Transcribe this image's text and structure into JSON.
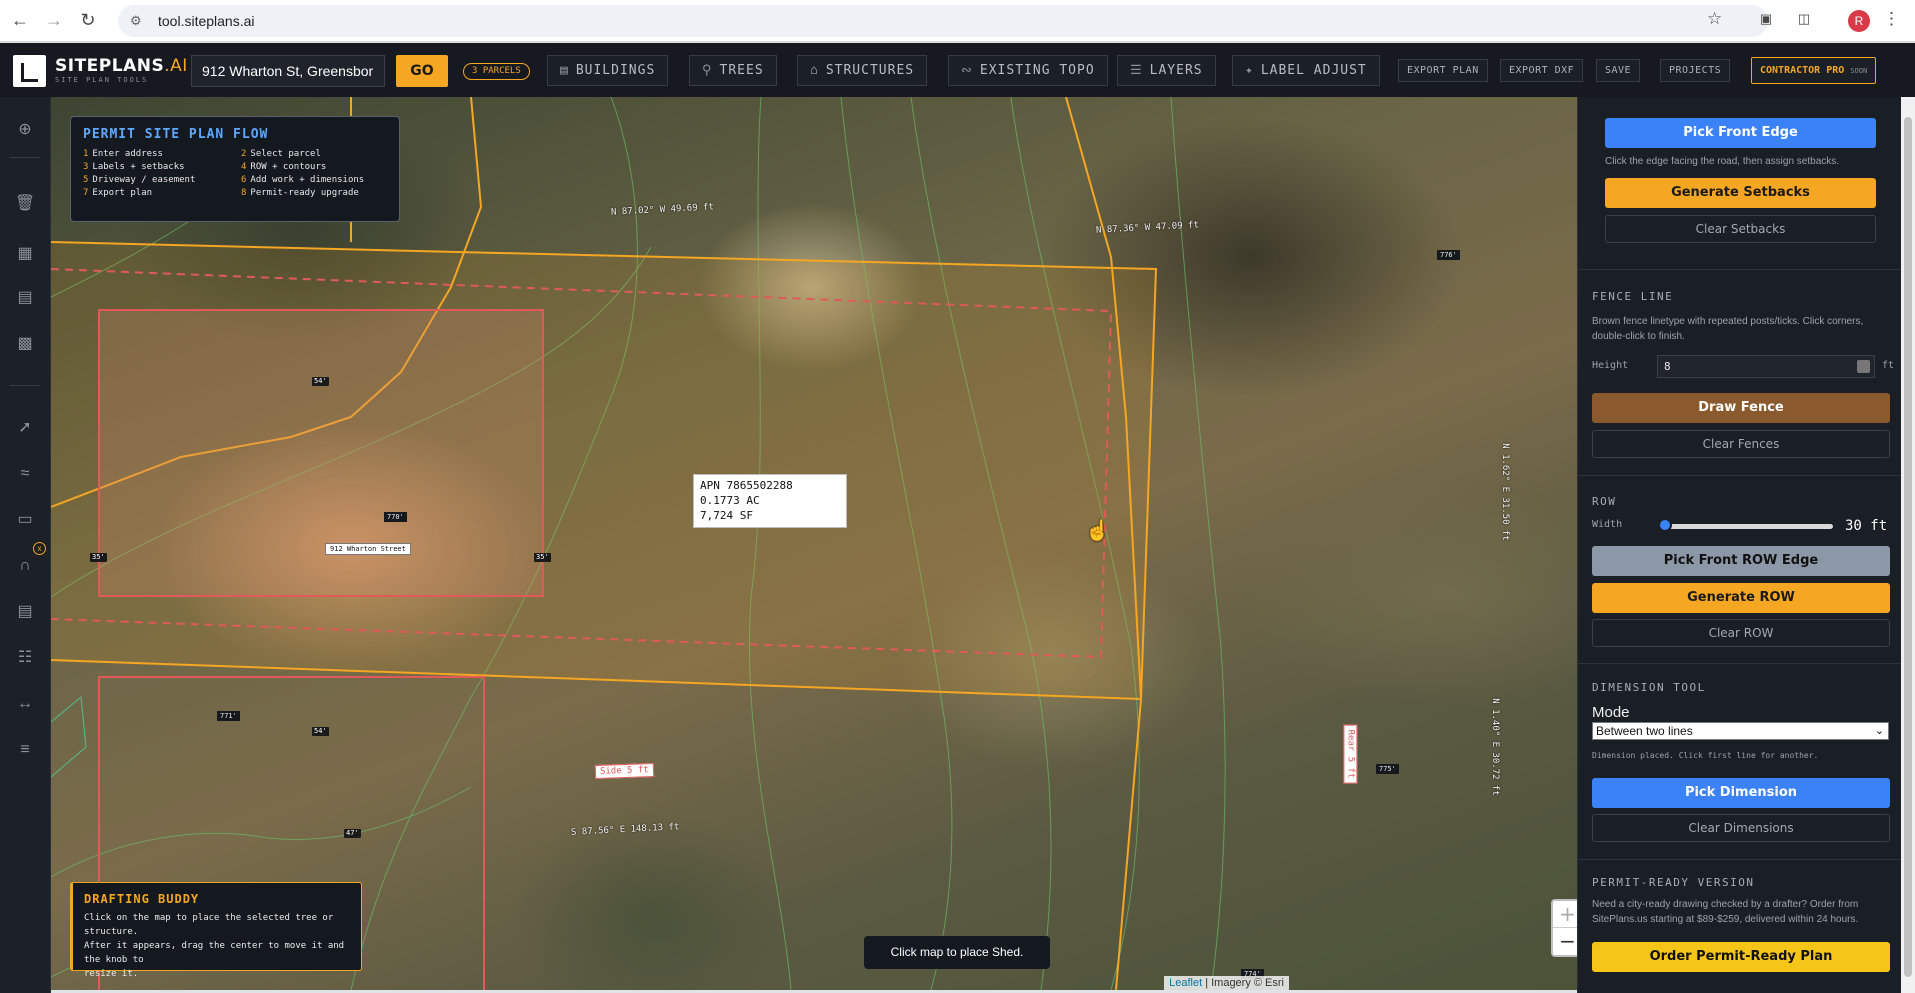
{
  "browser": {
    "url": "tool.siteplans.ai"
  },
  "header": {
    "logo_title": "SITEPLANS",
    "logo_ai": ".AI",
    "logo_subtitle": "SITE PLAN TOOLS",
    "address_value": "912 Wharton St, Greensbor",
    "go_label": "GO",
    "parcel_badge": "3 PARCELS",
    "tools": [
      {
        "label": "BUILDINGS",
        "icon": "building-icon"
      },
      {
        "label": "TREES",
        "icon": "tree-icon"
      },
      {
        "label": "STRUCTURES",
        "icon": "structure-icon"
      },
      {
        "label": "EXISTING TOPO",
        "icon": "topo-icon"
      },
      {
        "label": "LAYERS",
        "icon": "layers-icon"
      },
      {
        "label": "LABEL ADJUST",
        "icon": "label-adjust-icon"
      }
    ],
    "export_plan": "EXPORT PLAN",
    "export_dxf": "EXPORT DXF",
    "save": "SAVE",
    "projects": "PROJECTS",
    "contractor_pro": "CONTRACTOR PRO",
    "soon": "SOON"
  },
  "flow": {
    "title": "PERMIT SITE PLAN FLOW",
    "steps": [
      {
        "n": "1",
        "text": "Enter address"
      },
      {
        "n": "2",
        "text": "Select parcel"
      },
      {
        "n": "3",
        "text": "Labels + setbacks"
      },
      {
        "n": "4",
        "text": "ROW + contours"
      },
      {
        "n": "5",
        "text": "Driveway / easement"
      },
      {
        "n": "6",
        "text": "Add work + dimensions"
      },
      {
        "n": "7",
        "text": "Export plan"
      },
      {
        "n": "8",
        "text": "Permit-ready upgrade"
      }
    ]
  },
  "map": {
    "apn_lines": [
      "APN 7865502288",
      "0.1773 AC",
      "7,724 SF"
    ],
    "street_label": "912 Wharton Street",
    "bearing_top_left": "N 87.02° W 49.69 ft",
    "bearing_top_right": "N 87.36° W 47.09 ft",
    "bearing_bottom": "S 87.56° E 148.13 ft",
    "bearing_right_1": "N 1.62° E 31.50 ft",
    "bearing_right_2": "N 1.40° E 30.72 ft",
    "side_setback": "Side 5 ft",
    "rear_setback": "Rear 5 ft",
    "dims": [
      "54'",
      "54'",
      "35'",
      "35'",
      "47'"
    ],
    "elevations": [
      "770'",
      "771'",
      "776'",
      "775'",
      "774'"
    ],
    "toast": "Click map to place Shed.",
    "attribution_link": "Leaflet",
    "attribution_rest": "| Imagery © Esri",
    "zoom_in": "+",
    "zoom_out": "−"
  },
  "buddy": {
    "title": "DRAFTING BUDDY",
    "line1": "Click on the map to place the selected tree or structure.",
    "line2": "After it appears, drag the center to move it and the knob to",
    "line3": "resize it."
  },
  "panel": {
    "pick_front_edge": "Pick Front Edge",
    "front_edge_note": "Click the edge facing the road, then assign setbacks.",
    "generate_setbacks": "Generate Setbacks",
    "clear_setbacks": "Clear Setbacks",
    "fence_title": "FENCE LINE",
    "fence_note": "Brown fence linetype with repeated posts/ticks. Click corners, double-click to finish.",
    "height_label": "Height",
    "height_value": "8",
    "height_unit": "ft",
    "draw_fence": "Draw Fence",
    "clear_fences": "Clear Fences",
    "row_title": "ROW",
    "width_label": "Width",
    "row_width": "30 ft",
    "row_width_fraction": 0.0,
    "pick_front_row": "Pick Front ROW Edge",
    "generate_row": "Generate ROW",
    "clear_row": "Clear ROW",
    "dim_title": "DIMENSION TOOL",
    "mode_label": "Mode",
    "mode_value": "Between two lines",
    "dim_note": "Dimension placed. Click first line for another.",
    "pick_dimension": "Pick Dimension",
    "clear_dimensions": "Clear Dimensions",
    "permit_title": "PERMIT-READY VERSION",
    "permit_note": "Need a city-ready drawing checked by a drafter? Order from SitePlans.us starting at $89-$259, delivered within 24 hours.",
    "order_plan": "Order Permit-Ready Plan"
  },
  "colors": {
    "accent": "#f5a623",
    "blue": "#3b82f6",
    "fence_brown": "#8a5a2e",
    "setback_red": "#e05a5a"
  }
}
